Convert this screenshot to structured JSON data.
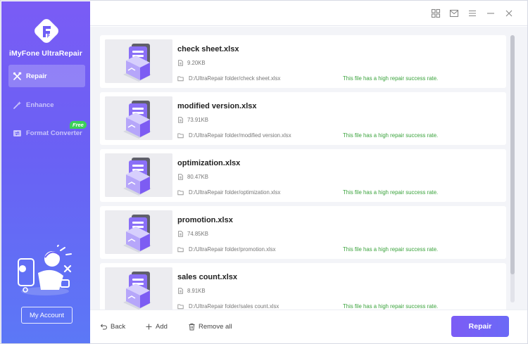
{
  "app": {
    "name": "iMyFone UltraRepair",
    "accent": "#7b5cf5",
    "success_color": "#3aa33c"
  },
  "sidebar": {
    "items": [
      {
        "label": "Repair",
        "icon": "repair-tools-icon",
        "active": true
      },
      {
        "label": "Enhance",
        "icon": "enhance-wand-icon",
        "active": false
      },
      {
        "label": "Format Converter",
        "icon": "format-converter-icon",
        "active": false,
        "badge": "Free"
      }
    ],
    "account_label": "My Account"
  },
  "titlebar": {
    "icons": [
      "grid-icon",
      "mail-icon",
      "menu-icon",
      "minimize-icon",
      "close-icon"
    ]
  },
  "files": [
    {
      "name": "check sheet.xlsx",
      "size": "9.20KB",
      "path": "D:/UltraRepair folder/check sheet.xlsx",
      "status": "This file has a high repair success rate."
    },
    {
      "name": "modified version.xlsx",
      "size": "73.91KB",
      "path": "D:/UltraRepair folder/modified version.xlsx",
      "status": "This file has a high repair success rate."
    },
    {
      "name": "optimization.xlsx",
      "size": "80.47KB",
      "path": "D:/UltraRepair folder/optimization.xlsx",
      "status": "This file has a high repair success rate."
    },
    {
      "name": "promotion.xlsx",
      "size": "74.85KB",
      "path": "D:/UltraRepair folder/promotion.xlsx",
      "status": "This file has a high repair success rate."
    },
    {
      "name": "sales count.xlsx",
      "size": "8.91KB",
      "path": "D:/UltraRepair folder/sales count.xlsx",
      "status": "This file has a high repair success rate."
    }
  ],
  "bottom": {
    "back_label": "Back",
    "add_label": "Add",
    "remove_label": "Remove all",
    "repair_label": "Repair"
  }
}
